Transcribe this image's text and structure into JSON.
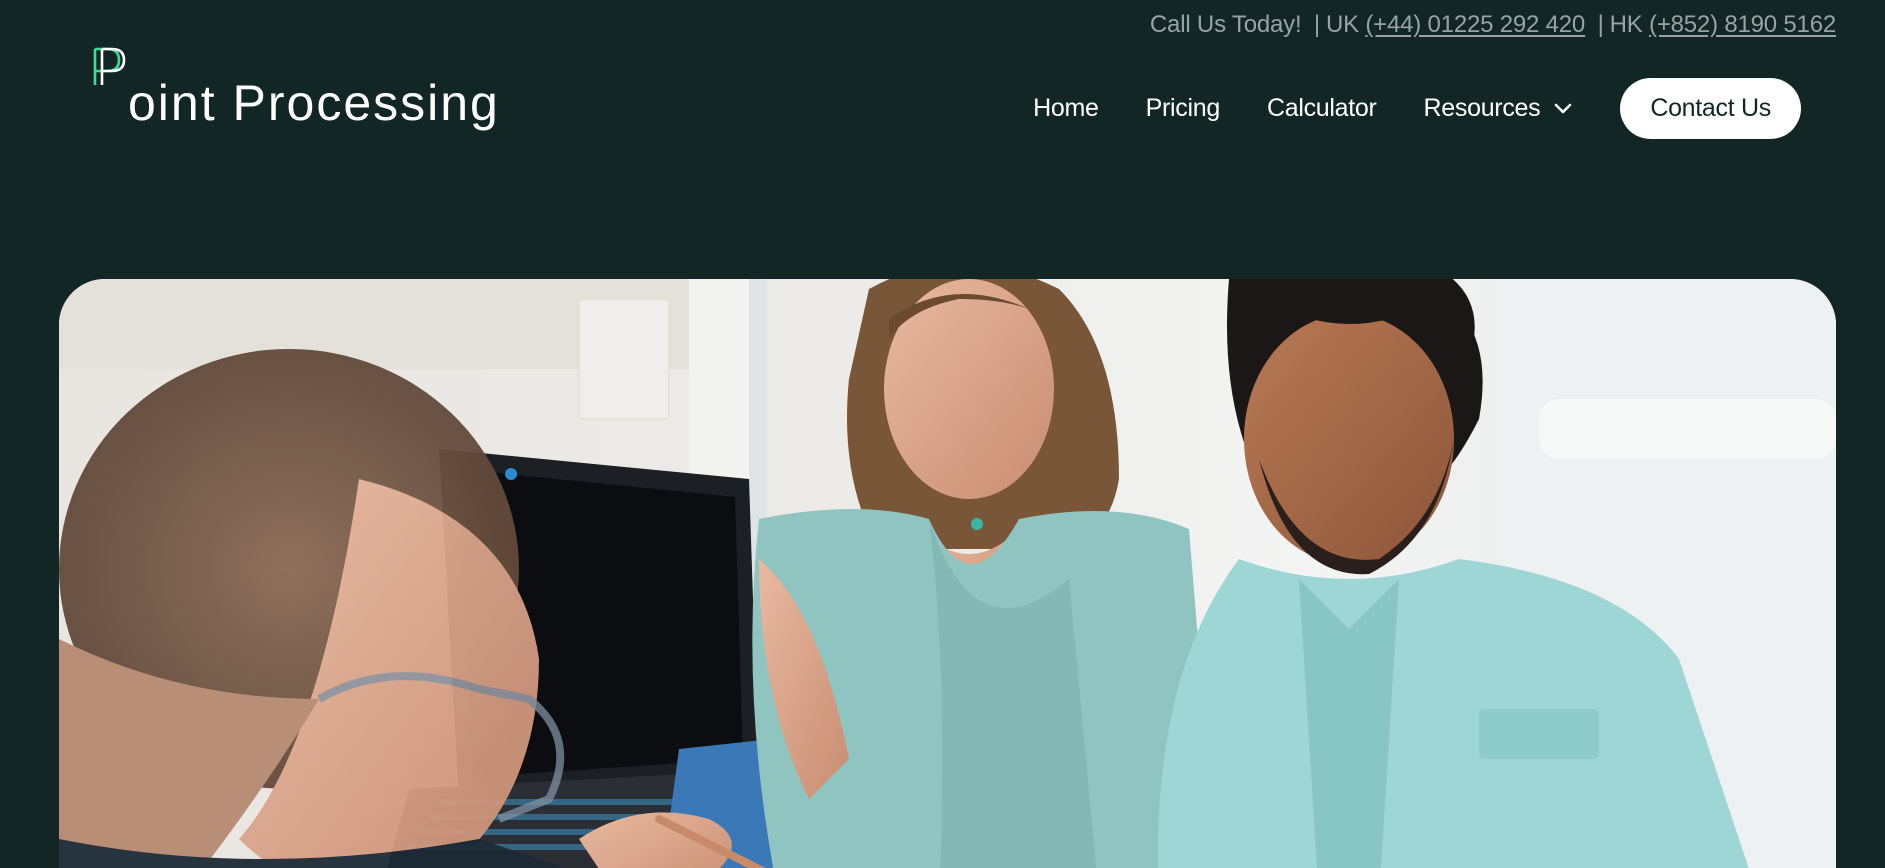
{
  "topbar": {
    "call_label": "Call Us Today!",
    "separator": "|",
    "uk_label": "UK",
    "uk_phone": "(+44) 01225 292 420",
    "hk_label": "HK",
    "hk_phone": "(+852) 8190 5162"
  },
  "brand": {
    "logo_rest": "oint Processing",
    "accent_color": "#3ddc97"
  },
  "nav": {
    "items": [
      {
        "label": "Home"
      },
      {
        "label": "Pricing"
      },
      {
        "label": "Calculator"
      },
      {
        "label": "Resources",
        "icon": "chevron-down-icon"
      }
    ],
    "cta_label": "Contact Us"
  },
  "hero": {
    "image": "three-people-reviewing-document-at-laptop"
  },
  "colors": {
    "background": "#132626",
    "text": "#ffffff",
    "muted": "#98a3a3"
  }
}
